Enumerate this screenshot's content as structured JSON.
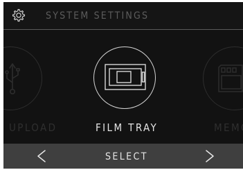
{
  "header": {
    "icon": "gear-icon",
    "title": "SYSTEM SETTINGS"
  },
  "carousel": {
    "items": [
      {
        "label": "UPLOAD",
        "icon": "usb-icon",
        "selected": false
      },
      {
        "label": "FILM TRAY",
        "icon": "film-tray-icon",
        "selected": true
      },
      {
        "label": "MEMO",
        "icon": "memory-card-icon",
        "selected": false
      }
    ]
  },
  "footer": {
    "prev_icon": "chevron-left-icon",
    "select_label": "SELECT",
    "next_icon": "chevron-right-icon"
  },
  "colors": {
    "background": "#121212",
    "footer": "#3f3f3f",
    "selected_text": "#e4e4e4",
    "dim_text": "#2f2f2f",
    "header_text": "#5c5c5c"
  }
}
